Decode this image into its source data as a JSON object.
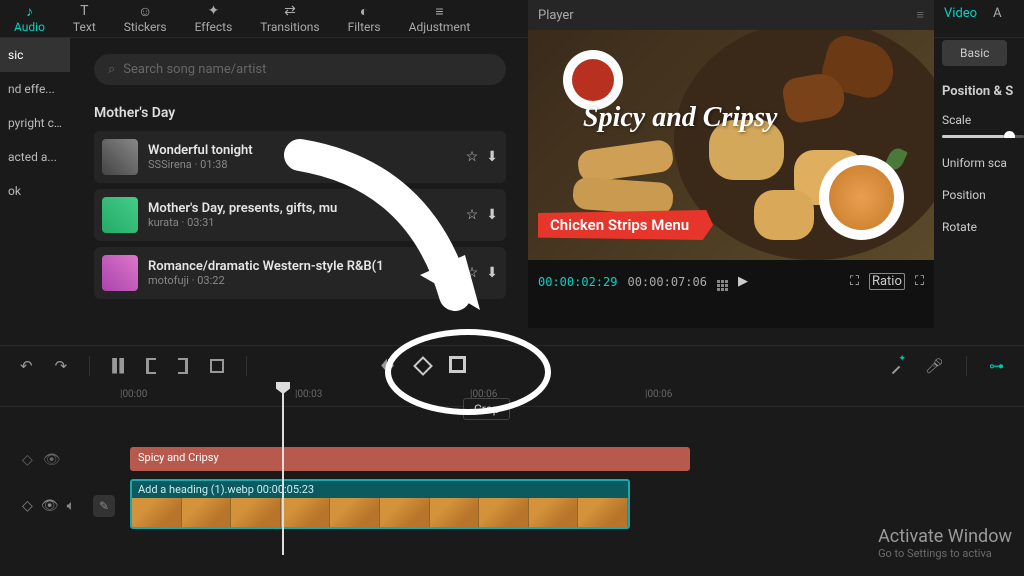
{
  "tabs": {
    "audio": "Audio",
    "text": "Text",
    "stickers": "Stickers",
    "effects": "Effects",
    "transitions": "Transitions",
    "filters": "Filters",
    "adjustment": "Adjustment"
  },
  "leftCats": {
    "c0": "sic",
    "c1": "nd effe...",
    "c2": "pyright c...",
    "c3": "acted a...",
    "c4": "ok"
  },
  "search": {
    "placeholder": "Search song name/artist"
  },
  "audio": {
    "section": "Mother's Day",
    "tracks": [
      {
        "title": "Wonderful tonight",
        "artist": "SSSirena",
        "dur": "01:38"
      },
      {
        "title": "Mother's Day, presents, gifts, mu",
        "artist": "kurata",
        "dur": "03:31"
      },
      {
        "title": "Romance/dramatic Western-style R&B(1",
        "artist": "motofuji",
        "dur": "03:22"
      }
    ]
  },
  "player": {
    "label": "Player",
    "headline": "Spicy and Cripsy",
    "brush": "Chicken Strips Menu",
    "tc1": "00:00:02:29",
    "tc2": "00:00:07:06",
    "ratio": "Ratio"
  },
  "props": {
    "tabVideo": "Video",
    "tabA": "A",
    "basic": "Basic",
    "group": "Position & S",
    "scale": "Scale",
    "uniform": "Uniform sca",
    "position": "Position",
    "rotate": "Rotate"
  },
  "tooltip": "Crop",
  "ruler": {
    "t0": "|00:00",
    "t1": "|00:03",
    "t2": "|00:06",
    "t3": "|00:06"
  },
  "clips": {
    "c1": "Spicy and Cripsy",
    "c2": "Add a heading (1).webp   00:00:05:23"
  },
  "watermark": {
    "t1": "Activate Window",
    "t2": "Go to Settings to activa"
  }
}
